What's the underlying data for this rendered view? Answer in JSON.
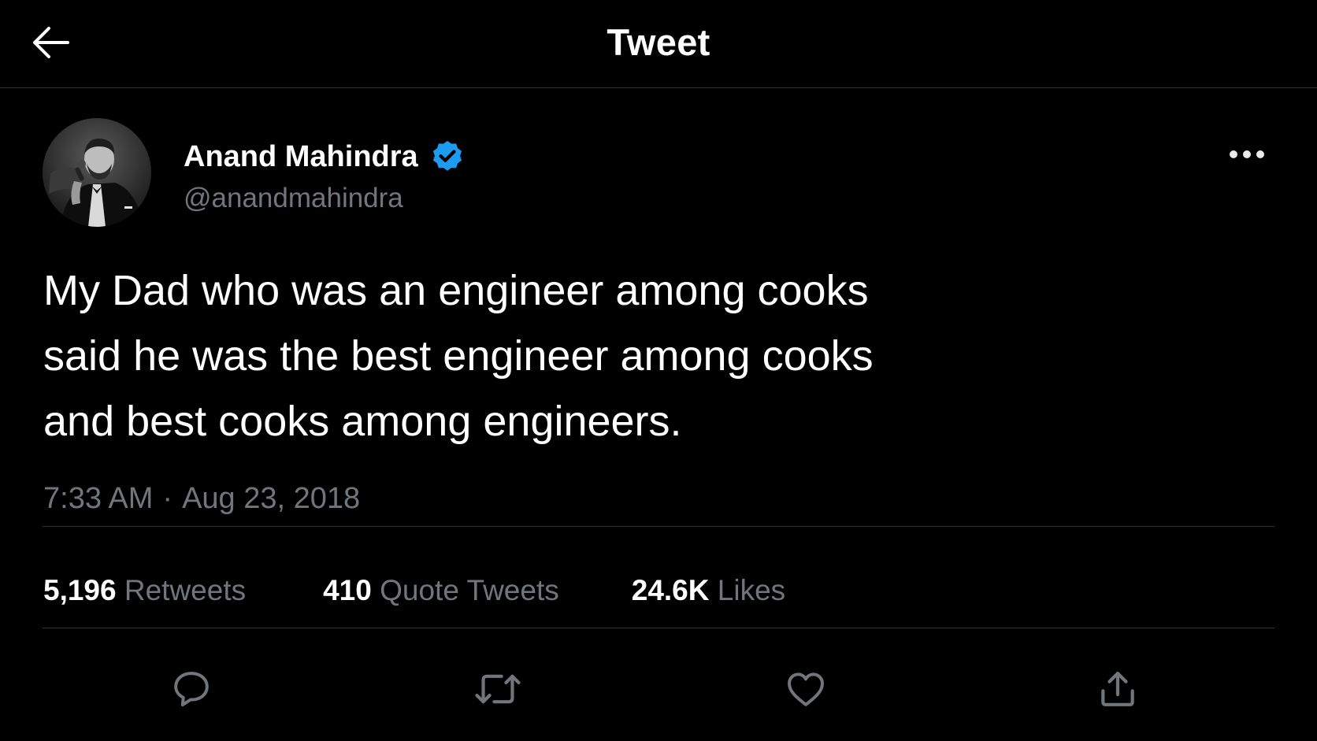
{
  "header": {
    "title": "Tweet",
    "back_icon": "arrow-left-icon"
  },
  "tweet": {
    "author": {
      "name": "Anand Mahindra",
      "handle": "@anandmahindra",
      "verified": true,
      "verified_color": "#1d9bf0"
    },
    "text_lines": [
      "My Dad who was an engineer among cooks",
      "said he was the best engineer among cooks",
      "and best cooks among engineers."
    ],
    "time": "7:33 AM",
    "separator": "·",
    "date": "Aug 23, 2018",
    "stats": {
      "retweets": {
        "count": "5,196",
        "label": "Retweets"
      },
      "quotes": {
        "count": "410",
        "label": "Quote Tweets"
      },
      "likes": {
        "count": "24.6K",
        "label": "Likes"
      }
    }
  },
  "actions": [
    {
      "name": "reply",
      "icon": "reply-icon"
    },
    {
      "name": "retweet",
      "icon": "retweet-icon"
    },
    {
      "name": "like",
      "icon": "heart-icon"
    },
    {
      "name": "share",
      "icon": "share-icon"
    }
  ],
  "colors": {
    "background": "#000000",
    "primary_text": "#ffffff",
    "secondary_text": "#71767b",
    "divider": "#2f3336",
    "accent": "#1d9bf0"
  }
}
